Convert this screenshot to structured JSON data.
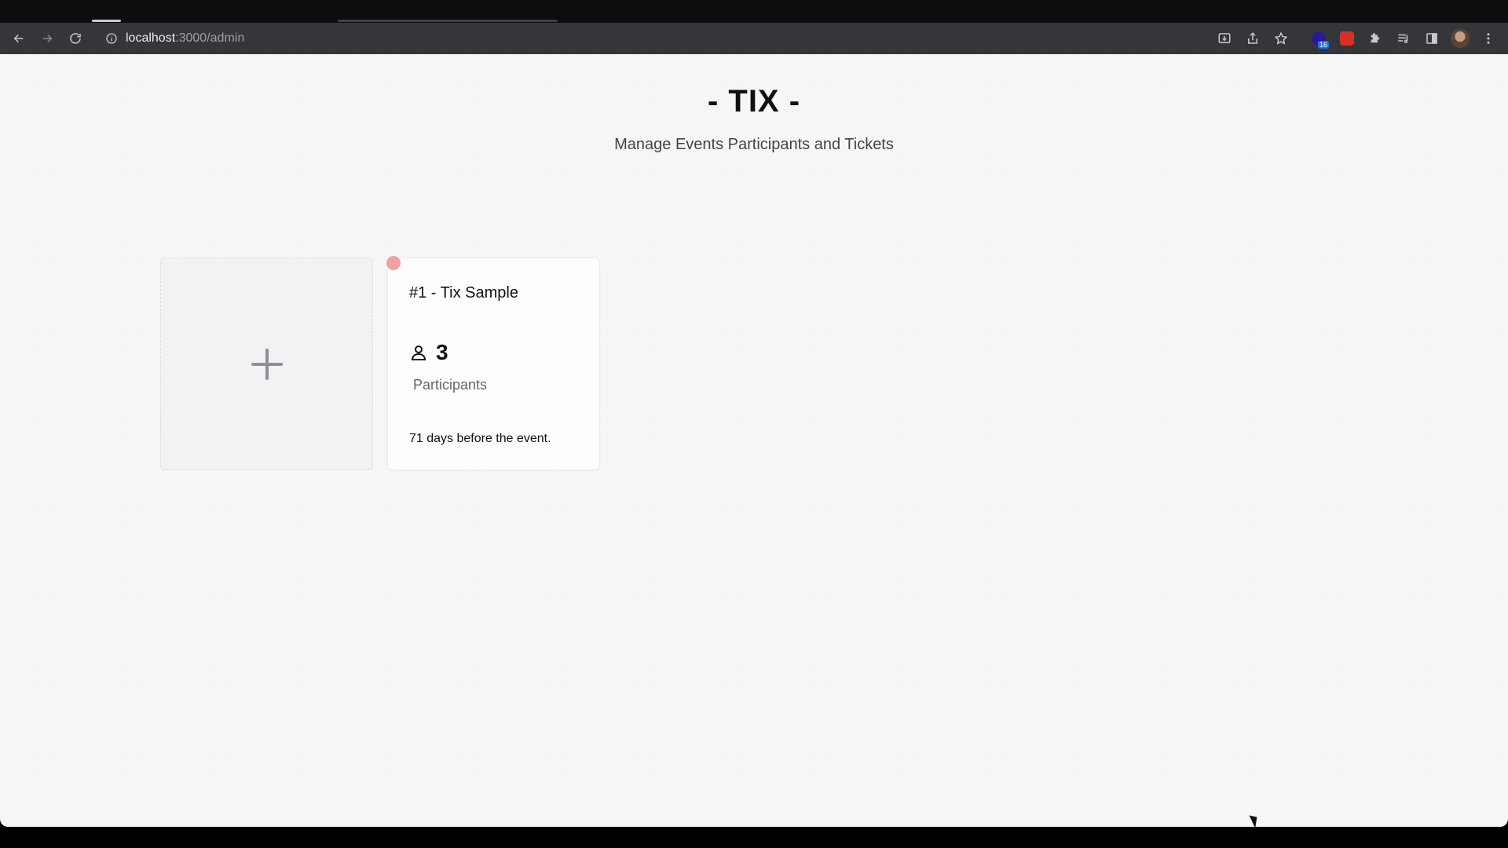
{
  "browser": {
    "url_host": "localhost",
    "url_path": ":3000/admin",
    "icons": {
      "back": "arrow-left-icon",
      "forward": "arrow-right-icon",
      "reload": "reload-icon",
      "info": "info-icon",
      "install": "install-icon",
      "share": "share-icon",
      "bookmark": "star-icon",
      "extensions": "puzzle-icon",
      "media": "media-icon",
      "sidepanel": "side-panel-icon",
      "menu": "kebab-menu-icon"
    },
    "extension_badge_count": "16"
  },
  "header": {
    "title": "- TIX -",
    "subtitle": "Manage Events Participants and Tickets"
  },
  "cards": {
    "add_card_icon": "plus-icon",
    "event": {
      "title": "#1 - Tix Sample",
      "participant_count": "3",
      "participants_label": "Participants",
      "countdown": "71 days before the event.",
      "status_color": "#f2a0a0"
    }
  }
}
